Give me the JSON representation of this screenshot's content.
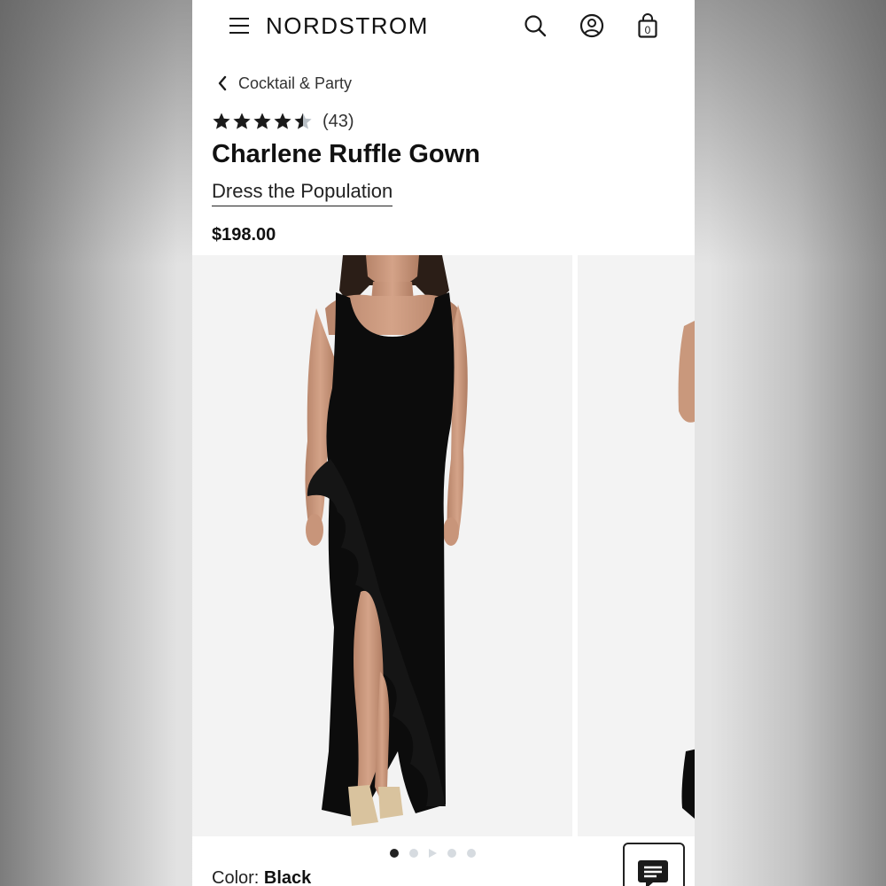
{
  "header": {
    "logo": "NORDSTROM",
    "icons": [
      "menu-icon",
      "search-icon",
      "account-icon",
      "shopping-bag-icon"
    ],
    "bag_count": "0"
  },
  "breadcrumb": {
    "label": "Cocktail & Party"
  },
  "product": {
    "rating": 4.5,
    "rating_max": 5,
    "review_count": "(43)",
    "title": "Charlene Ruffle Gown",
    "brand": "Dress the Population",
    "price": "$198.00",
    "color_label": "Color:",
    "color_value": "Black"
  },
  "gallery": {
    "image_count": 5,
    "active_index": 0,
    "video_index": 2
  },
  "colors": {
    "star": "#1a1a1a",
    "star_empty": "#b9c0c6",
    "dot_inactive": "#d6dbe0",
    "dress": "#0c0c0c",
    "skin": "#c9987c"
  }
}
